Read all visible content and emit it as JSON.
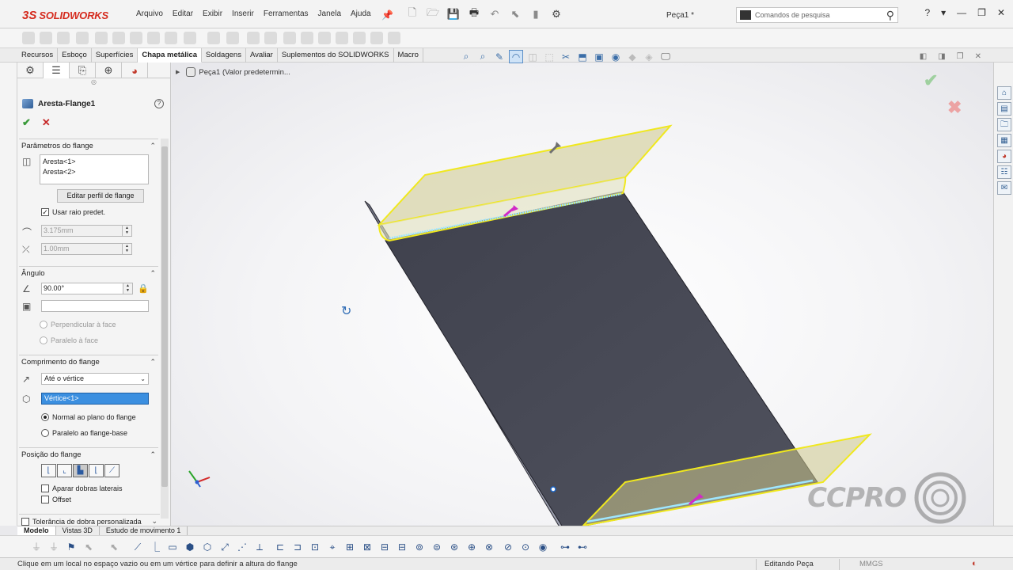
{
  "app": {
    "logo_prefix": "3S",
    "logo_text": "SOLIDWORKS",
    "document_title": "Peça1 *",
    "menu": [
      "Arquivo",
      "Editar",
      "Exibir",
      "Inserir",
      "Ferramentas",
      "Janela",
      "Ajuda"
    ],
    "search_placeholder": "Comandos de pesquisa",
    "window_buttons": [
      "?",
      "▾",
      "—",
      "❐",
      "✕"
    ]
  },
  "command_tabs": [
    {
      "label": "Recursos",
      "active": false
    },
    {
      "label": "Esboço",
      "active": false
    },
    {
      "label": "Superfícies",
      "active": false
    },
    {
      "label": "Chapa metálica",
      "active": true
    },
    {
      "label": "Soldagens",
      "active": false
    },
    {
      "label": "Avaliar",
      "active": false
    },
    {
      "label": "Suplementos do SOLIDWORKS",
      "active": false
    },
    {
      "label": "Macro",
      "active": false
    }
  ],
  "property_manager": {
    "feature_name": "Aresta-Flange1",
    "groups": {
      "params": {
        "title": "Parâmetros do flange",
        "edges": [
          "Aresta<1>",
          "Aresta<2>"
        ],
        "edit_profile_button": "Editar perfil de flange",
        "use_default_radius_label": "Usar raio predet.",
        "use_default_radius_checked": true,
        "radius_value": "3.175mm",
        "gap_value": "1.00mm"
      },
      "angle": {
        "title": "Ângulo",
        "angle_value": "90.00°",
        "reference_value": "",
        "option_perpendicular": "Perpendicular à face",
        "option_parallel": "Paralelo à face"
      },
      "length": {
        "title": "Comprimento do flange",
        "end_condition": "Até o vértice",
        "vertex_value": "Vértice<1>",
        "option_normal": "Normal ao plano do flange",
        "option_parallel_base": "Paralelo ao flange-base",
        "selected_option": "normal"
      },
      "position": {
        "title": "Posição do flange",
        "trim_side_bends_label": "Aparar dobras laterais",
        "offset_label": "Offset"
      },
      "tolerance": {
        "title": "Tolerância de dobra personalizada"
      }
    }
  },
  "graphics": {
    "tree_flyout_text": "Peça1  (Valor predetermin...",
    "watermark_text": "CCPRO"
  },
  "bottom_tabs": [
    {
      "label": "Modelo",
      "active": true
    },
    {
      "label": "Vistas 3D",
      "active": false
    },
    {
      "label": "Estudo de movimento 1",
      "active": false
    }
  ],
  "status": {
    "message": "Clique em um local no espaço vazio ou em um vértice para definir a altura do flange",
    "mode": "Editando Peça",
    "units": "MMGS"
  },
  "colors": {
    "accent": "#3b8fe0",
    "logo_red": "#d52b1e",
    "flange_highlight": "#f0e81e",
    "model_face": "#4a4c58"
  }
}
